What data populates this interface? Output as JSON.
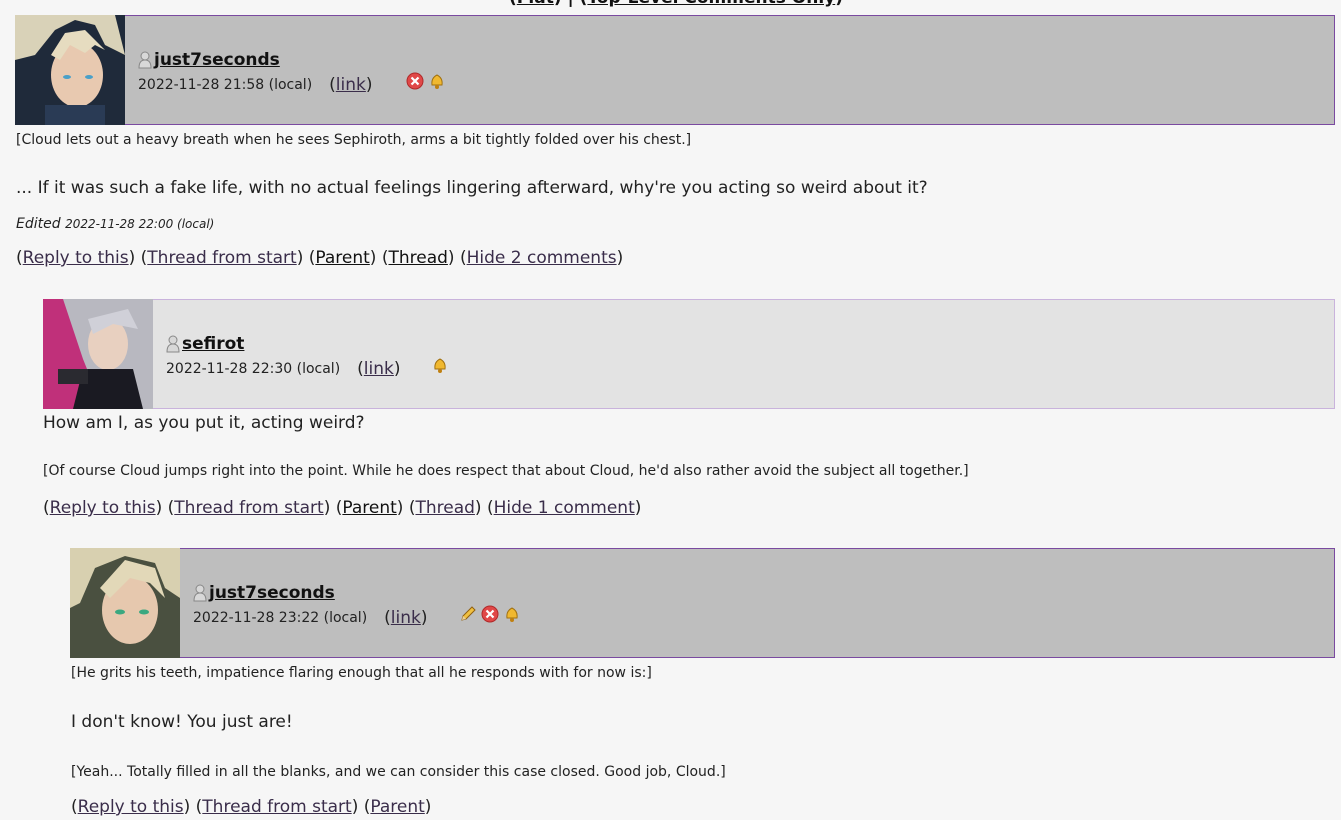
{
  "top_nav": {
    "open": "(",
    "expand_label": "Flat",
    "sep": ") | (",
    "top_label": "Top-Level Comments Only",
    "close": ")"
  },
  "comments": [
    {
      "username": "just7seconds",
      "date": "2022-11-28 21:58 (local)",
      "link_label": "link",
      "icons": [
        "delete-icon",
        "track-icon"
      ],
      "action_note": "[Cloud lets out a heavy breath when he sees Sephiroth, arms a bit tightly folded over his chest.]",
      "text": "... If it was such a fake life, with no actual feelings lingering afterward, why're you acting so weird about it?",
      "edited_label": "Edited",
      "edited_date": "2022-11-28 22:00 (local)",
      "actions": {
        "reply": "Reply to this",
        "thread_start": "Thread from start",
        "parent": "Parent",
        "thread": "Thread",
        "hide": "Hide 2 comments"
      }
    },
    {
      "username": "sefirot",
      "date": "2022-11-28 22:30 (local)",
      "link_label": "link",
      "icons": [
        "track-icon"
      ],
      "text": "How am I, as you put it, acting weird?",
      "action_note": "[Of course Cloud jumps right into the point. While he does respect that about Cloud, he'd also rather avoid the subject all together.]",
      "actions": {
        "reply": "Reply to this",
        "thread_start": "Thread from start",
        "parent": "Parent",
        "thread": "Thread",
        "hide": "Hide 1 comment"
      }
    },
    {
      "username": "just7seconds",
      "date": "2022-11-28 23:22 (local)",
      "link_label": "link",
      "icons": [
        "edit-icon",
        "delete-icon",
        "track-icon"
      ],
      "action_note": "[He grits his teeth, impatience flaring enough that all he responds with for now is:]",
      "text": "I don't know! You just are!",
      "action_note_2": "[Yeah... Totally filled in all the blanks, and we can consider this case closed. Good job, Cloud.]",
      "actions": {
        "reply": "Reply to this",
        "thread_start": "Thread from start",
        "parent": "Parent"
      }
    }
  ],
  "colors": {
    "header_dark": "#bebebe",
    "header_light": "#e3e3e3",
    "border": "#7a4aa0",
    "link": "#3a2d4a"
  }
}
